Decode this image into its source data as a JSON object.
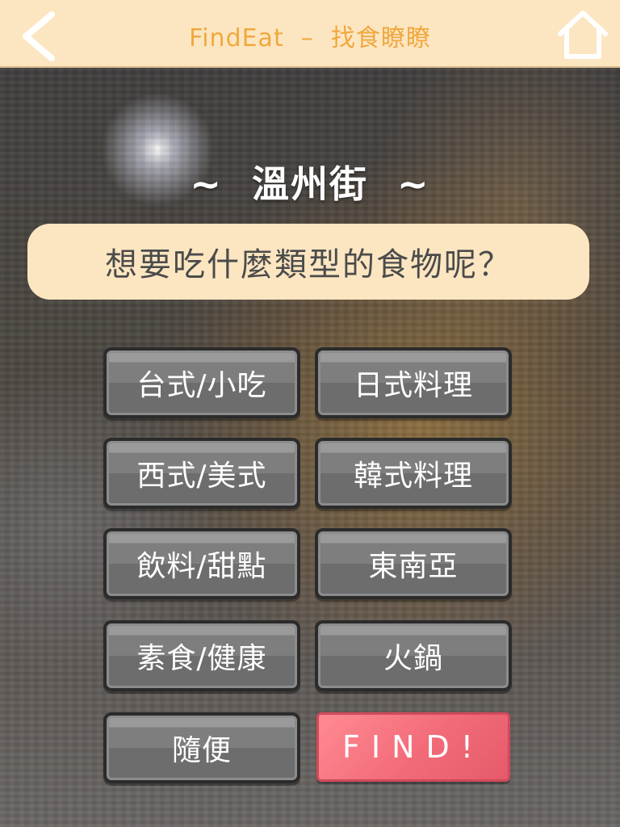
{
  "header": {
    "title": "FindEat  –  找食瞭瞭",
    "back_icon": "back-chevron-icon",
    "home_icon": "home-icon"
  },
  "location": "~  溫州街  ~",
  "question": "想要吃什麼類型的食物呢？",
  "categories": [
    "台式/小吃",
    "日式料理",
    "西式/美式",
    "韓式料理",
    "飲料/甜點",
    "東南亞",
    "素食/健康",
    "火鍋",
    "隨便"
  ],
  "find_button": "FIND!",
  "colors": {
    "header_bg": "#fce6c1",
    "header_text": "#f1a83e",
    "button_gray": "#7e7e7e",
    "find_pink": "#f26b78"
  }
}
